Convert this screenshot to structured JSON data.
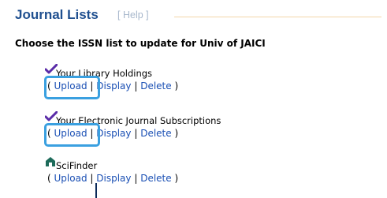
{
  "header": {
    "title": "Journal Lists",
    "help_open": "[",
    "help_label": "Help",
    "help_close": "]"
  },
  "subtitle": "Choose the ISSN list to update for Univ of JAICI",
  "lists": [
    {
      "title": "Your Library Holdings",
      "icon": "checkmark-icon",
      "actions": [
        "Upload",
        "Display",
        "Delete"
      ]
    },
    {
      "title": "Your Electronic Journal Subscriptions",
      "icon": "checkmark-icon",
      "actions": [
        "Upload",
        "Display",
        "Delete"
      ]
    },
    {
      "title": "SciFinder",
      "icon": "house-icon",
      "actions": [
        "Upload",
        "Display",
        "Delete"
      ]
    }
  ],
  "punctuation": {
    "open": "(",
    "close": ")",
    "sep": "|"
  },
  "colors": {
    "title": "#1f4f8f",
    "link": "#1a4fb4",
    "highlight": "#3aa0e0",
    "checkmark": "#5a2ca8",
    "house": "#1d6b5a"
  }
}
